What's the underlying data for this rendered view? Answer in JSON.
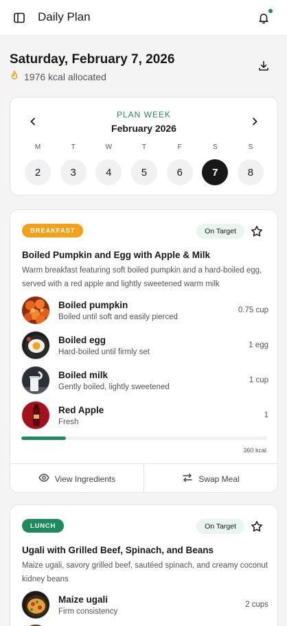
{
  "header": {
    "title": "Daily Plan"
  },
  "date": {
    "title": "Saturday, February 7, 2026",
    "kcal_text": "1976 kcal allocated"
  },
  "calendar": {
    "kicker": "PLAN WEEK",
    "month": "February 2026",
    "days": [
      {
        "letter": "M",
        "num": "2"
      },
      {
        "letter": "T",
        "num": "3"
      },
      {
        "letter": "W",
        "num": "4"
      },
      {
        "letter": "T",
        "num": "5"
      },
      {
        "letter": "F",
        "num": "6"
      },
      {
        "letter": "S",
        "num": "7"
      },
      {
        "letter": "S",
        "num": "8"
      }
    ],
    "selected_index": 5
  },
  "breakfast": {
    "tag": "BREAKFAST",
    "status": "On Target",
    "title": "Boiled Pumpkin and Egg with Apple & Milk",
    "desc": "Warm breakfast featuring soft boiled pumpkin and a hard-boiled egg, served with a red apple and lightly sweetened warm milk",
    "items": [
      {
        "name": "Boiled pumpkin",
        "sub": "Boiled until soft and easily pierced",
        "qty": "0.75 cup"
      },
      {
        "name": "Boiled egg",
        "sub": "Hard-boiled until firmly set",
        "qty": "1 egg"
      },
      {
        "name": "Boiled milk",
        "sub": "Gently boiled, lightly sweetened",
        "qty": "1 cup"
      },
      {
        "name": "Red Apple",
        "sub": "Fresh",
        "qty": "1"
      }
    ],
    "progress_fraction": 0.18,
    "kcal": "360 kcal",
    "view_label": "View Ingredients",
    "swap_label": "Swap Meal"
  },
  "lunch": {
    "tag": "LUNCH",
    "status": "On Target",
    "title": "Ugali with Grilled Beef, Spinach, and Beans",
    "desc": "Maize ugali, savory grilled beef, sautéed spinach, and creamy coconut kidney beans",
    "items": [
      {
        "name": "Maize ugali",
        "sub": "Firm consistency",
        "qty": "2 cups"
      }
    ]
  },
  "colors": {
    "accent": "#1f8a5b",
    "breakfast_tag": "#f4a11a",
    "selected_day": "#18181b"
  },
  "icons": [
    "sidebar-icon",
    "bell-icon",
    "flame-icon",
    "download-icon",
    "chevron-left-icon",
    "chevron-right-icon",
    "star-icon",
    "eye-icon",
    "swap-icon"
  ]
}
